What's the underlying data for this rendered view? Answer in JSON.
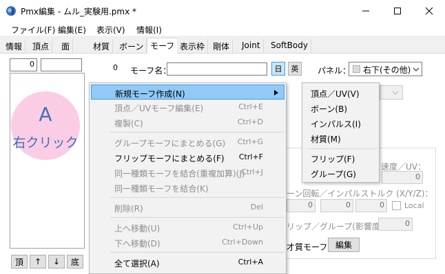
{
  "window": {
    "title": "Pmx編集 - ムル_実験用.pmx *",
    "controls": [
      "minimize",
      "maximize",
      "close"
    ]
  },
  "menubar": [
    "ファイル(F)",
    "編集(E)",
    "表示(V)",
    "情報(I)"
  ],
  "tabs": [
    "情報",
    "頂点",
    "面",
    "材質",
    "ボーン",
    "モーフ",
    "表示枠",
    "剛体",
    "Joint",
    "SoftBody"
  ],
  "active_tab": "モーフ",
  "left": {
    "index_value": "0",
    "name_value": "",
    "count_label": "0",
    "nav_buttons": [
      "頂",
      "↑",
      "↓",
      "底"
    ]
  },
  "overlay": {
    "letter": "A",
    "caption": "右クリック",
    "color": "#fbcde4"
  },
  "morph": {
    "name_label": "モーフ名：",
    "name_value": "",
    "lang_jp": "日",
    "lang_en": "英",
    "panel_label": "パネル：",
    "panel_value": "右下(その他)"
  },
  "properties": {
    "velocity_partial": "速度／UV：",
    "velocity_value": "0",
    "impulse_partial": "ーン回転／インパルストルク (X/Y/Z)：",
    "impulse_values": [
      "0",
      "0",
      "0"
    ],
    "local_label": "Local",
    "flip_partial": "リップ／グループ(影響度)：",
    "flip_value": "0",
    "material_morph_partial": "才質モーフ：",
    "edit_button": "編集"
  },
  "context_menu": {
    "items": [
      {
        "label": "新規モーフ作成(N)",
        "shortcut": "",
        "submenu": true,
        "highlighted": true,
        "enabled": true
      },
      {
        "label": "頂点／UVモーフ編集(E)",
        "shortcut": "Ctrl+E",
        "enabled": false
      },
      {
        "label": "複製(C)",
        "shortcut": "Ctrl+D",
        "enabled": false
      },
      {
        "separator": true
      },
      {
        "label": "グループモーフにまとめる(G)",
        "shortcut": "Ctrl+G",
        "enabled": false
      },
      {
        "label": "フリップモーフにまとめる(F)",
        "shortcut": "Ctrl+F",
        "enabled": true
      },
      {
        "label": "同一種類モーフを結合(重複加算)(J)",
        "shortcut": "Ctrl+J",
        "enabled": false
      },
      {
        "label": "同一種類モーフを結合(K)",
        "shortcut": "",
        "enabled": false
      },
      {
        "separator": true
      },
      {
        "label": "削除(R)",
        "shortcut": "Del",
        "enabled": false
      },
      {
        "separator": true
      },
      {
        "label": "上へ移動(U)",
        "shortcut": "Ctrl+Up",
        "enabled": false
      },
      {
        "label": "下へ移動(D)",
        "shortcut": "Ctrl+Down",
        "enabled": false
      },
      {
        "separator": true
      },
      {
        "label": "全て選択(A)",
        "shortcut": "Ctrl+A",
        "enabled": true
      }
    ],
    "submenu": [
      {
        "label": "頂点／UV(V)"
      },
      {
        "label": "ボーン(B)"
      },
      {
        "label": "インパルス(I)"
      },
      {
        "label": "材質(M)"
      },
      {
        "separator": true
      },
      {
        "label": "フリップ(F)"
      },
      {
        "label": "グループ(G)"
      }
    ]
  }
}
